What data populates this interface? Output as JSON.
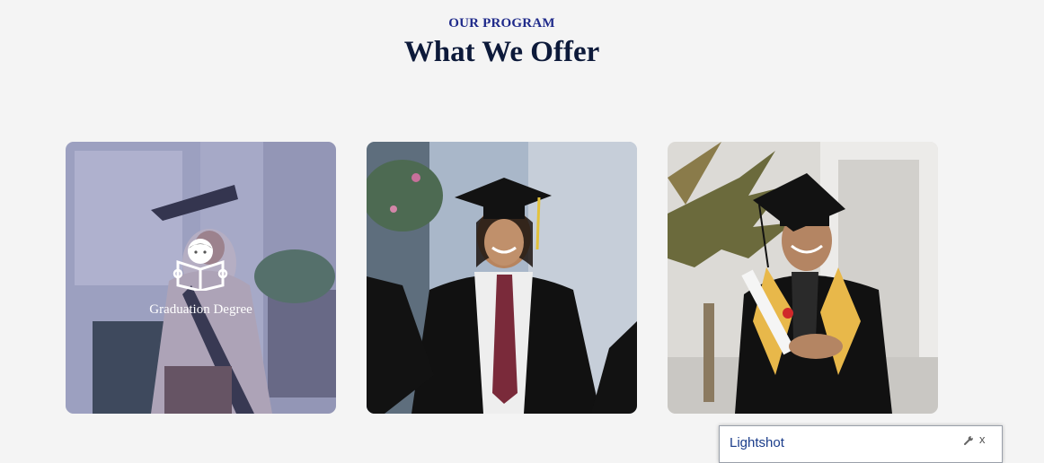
{
  "section": {
    "eyebrow": "OUR PROGRAM",
    "title": "What We Offer"
  },
  "cards": [
    {
      "label": "Graduation Degree",
      "icon": "student-reading-icon",
      "overlay_color": "#6062a0"
    },
    {
      "label": ""
    },
    {
      "label": ""
    }
  ],
  "lightshot": {
    "title": "Lightshot",
    "settings_icon": "wrench-icon",
    "close_label": "x"
  },
  "colors": {
    "page_background": "#f4f4f4",
    "eyebrow": "#1f2a8a",
    "heading": "#0d1a3a",
    "gown": "#111111",
    "stole": "#e8b84a"
  }
}
